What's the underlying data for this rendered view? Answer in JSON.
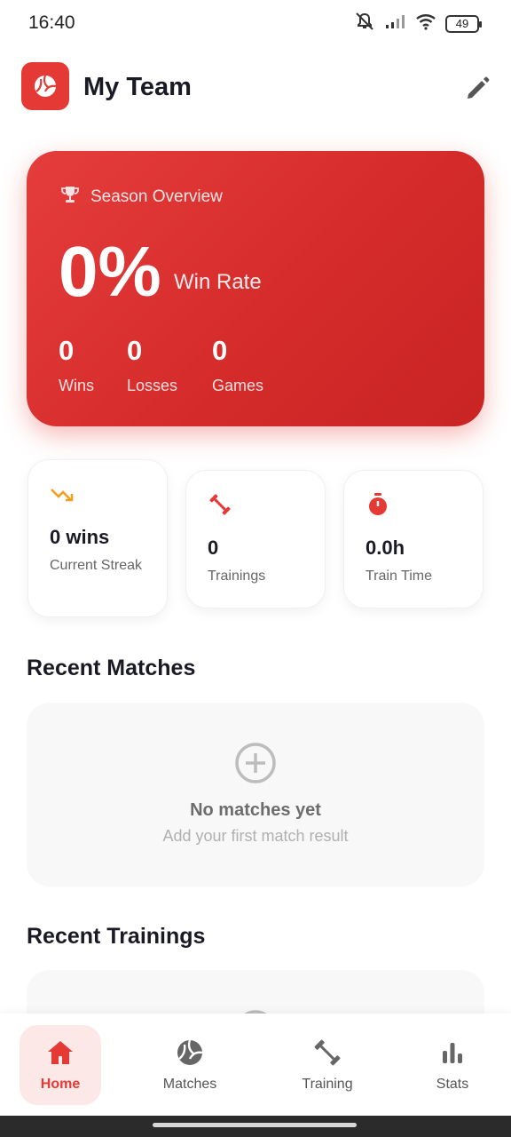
{
  "status_bar": {
    "time": "16:40",
    "battery": "49"
  },
  "header": {
    "title": "My Team"
  },
  "overview": {
    "heading": "Season Overview",
    "win_rate": "0%",
    "win_rate_label": "Win Rate",
    "stats": [
      {
        "value": "0",
        "label": "Wins"
      },
      {
        "value": "0",
        "label": "Losses"
      },
      {
        "value": "0",
        "label": "Games"
      }
    ]
  },
  "mini_stats": [
    {
      "value": "0 wins",
      "label": "Current Streak",
      "icon": "trending-down-icon",
      "color": "#f0a020"
    },
    {
      "value": "0",
      "label": "Trainings",
      "icon": "dumbbell-icon",
      "color": "#e53935"
    },
    {
      "value": "0.0h",
      "label": "Train Time",
      "icon": "stopwatch-icon",
      "color": "#e53935"
    }
  ],
  "recent_matches": {
    "title": "Recent Matches",
    "empty_title": "No matches yet",
    "empty_subtitle": "Add your first match result"
  },
  "recent_trainings": {
    "title": "Recent Trainings"
  },
  "nav": [
    {
      "label": "Home",
      "icon": "home-icon",
      "active": true
    },
    {
      "label": "Matches",
      "icon": "volleyball-icon",
      "active": false
    },
    {
      "label": "Training",
      "icon": "dumbbell-icon",
      "active": false
    },
    {
      "label": "Stats",
      "icon": "bar-chart-icon",
      "active": false
    }
  ],
  "colors": {
    "accent": "#e53935",
    "accent_light": "#fde8e8"
  }
}
